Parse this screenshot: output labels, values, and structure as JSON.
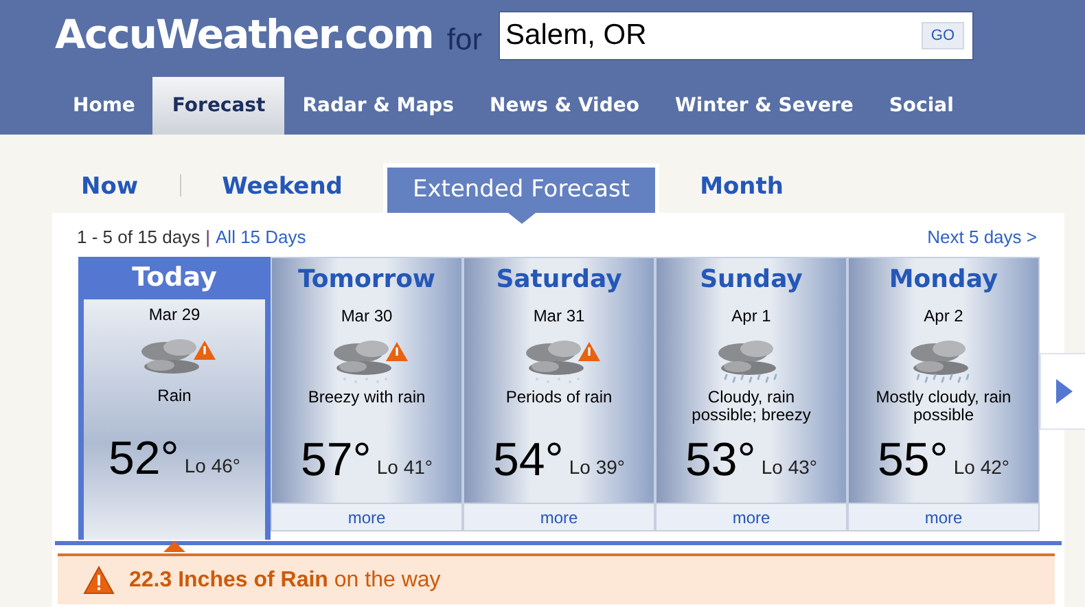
{
  "header": {
    "logo": "AccuWeather.com",
    "for_label": "for",
    "search": {
      "value": "Salem, OR"
    },
    "go_button": "GO"
  },
  "nav": [
    {
      "label": "Home",
      "selected": false
    },
    {
      "label": "Forecast",
      "selected": true
    },
    {
      "label": "Radar & Maps",
      "selected": false
    },
    {
      "label": "News & Video",
      "selected": false
    },
    {
      "label": "Winter & Severe",
      "selected": false
    },
    {
      "label": "Social",
      "selected": false
    }
  ],
  "subtabs": [
    {
      "label": "Now",
      "selected": false
    },
    {
      "label": "Weekend",
      "selected": false
    },
    {
      "label": "Extended Forecast",
      "selected": true
    },
    {
      "label": "Month",
      "selected": false
    }
  ],
  "range": {
    "label": "1 - 5 of 15 days",
    "separator": "|",
    "all_link": "All 15 Days",
    "next_link": "Next 5 days >"
  },
  "days": [
    {
      "name": "Today",
      "date": "Mar 29",
      "kind": "rain_alert",
      "condition": "Rain",
      "high": "52°",
      "low": "Lo 46°",
      "selected": true
    },
    {
      "name": "Tomorrow",
      "date": "Mar 30",
      "kind": "rain_alert",
      "condition": "Breezy with rain",
      "high": "57°",
      "low": "Lo 41°",
      "more": "more",
      "selected": false
    },
    {
      "name": "Saturday",
      "date": "Mar 31",
      "kind": "rain_alert",
      "condition": "Periods of rain",
      "high": "54°",
      "low": "Lo 39°",
      "more": "more",
      "selected": false
    },
    {
      "name": "Sunday",
      "date": "Apr 1",
      "kind": "showers",
      "condition": "Cloudy, rain possible; breezy",
      "high": "53°",
      "low": "Lo 43°",
      "more": "more",
      "selected": false
    },
    {
      "name": "Monday",
      "date": "Apr 2",
      "kind": "showers",
      "condition": "Mostly cloudy, rain possible",
      "high": "55°",
      "low": "Lo 42°",
      "more": "more",
      "selected": false
    }
  ],
  "alert": {
    "text": "**22.3 Inches of Rain** on the way"
  }
}
